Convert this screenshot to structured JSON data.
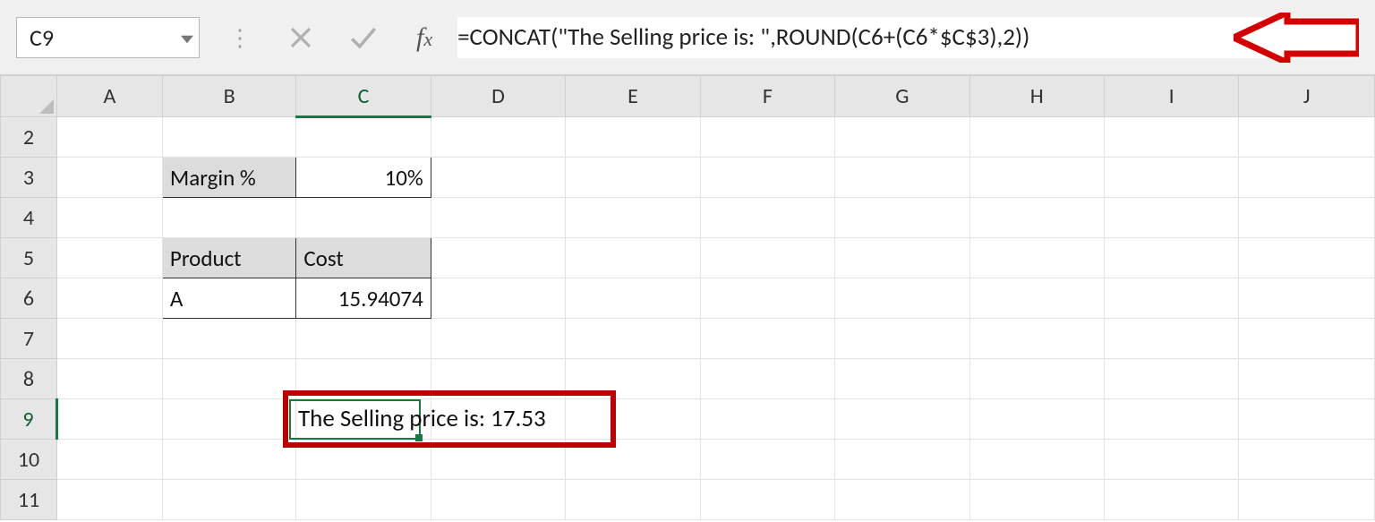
{
  "formula_bar": {
    "name_box": "C9",
    "formula": "=CONCAT(\"The Selling price is: \",ROUND(C6+(C6*$C$3),2))"
  },
  "columns": [
    "A",
    "B",
    "C",
    "D",
    "E",
    "F",
    "G",
    "H",
    "I",
    "J"
  ],
  "rows": [
    "2",
    "3",
    "4",
    "5",
    "6",
    "7",
    "8",
    "9",
    "10",
    "11"
  ],
  "cells": {
    "B3": "Margin %",
    "C3": "10%",
    "B5": "Product",
    "C5": "Cost",
    "B6": "A",
    "C6": "15.94074",
    "C9": "The Selling price is: 17.53"
  },
  "selected_cell": "C9"
}
